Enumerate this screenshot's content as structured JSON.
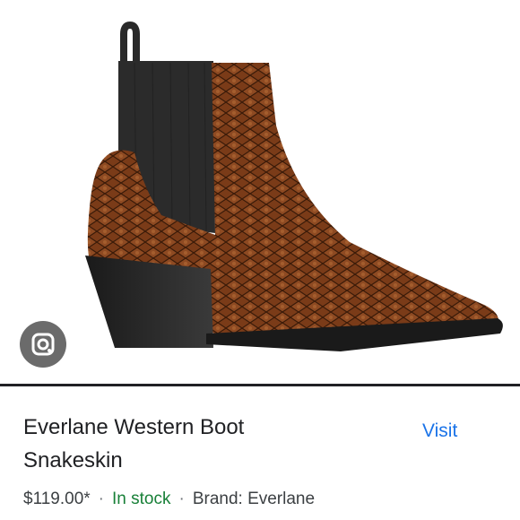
{
  "product": {
    "image_alt": "Snakeskin western ankle boot",
    "title_line1": "Everlane Western Boot",
    "title_line2": "Snakeskin",
    "price": "$119.00*",
    "stock": "In stock",
    "brand": "Brand: Everlane"
  },
  "actions": {
    "visit_label": "Visit",
    "lens_icon": "lens-camera-icon"
  },
  "colors": {
    "link": "#1a73e8",
    "in_stock": "#188038",
    "text": "#202124",
    "leather": "#7a3b18",
    "elastic": "#2b2b2b"
  }
}
